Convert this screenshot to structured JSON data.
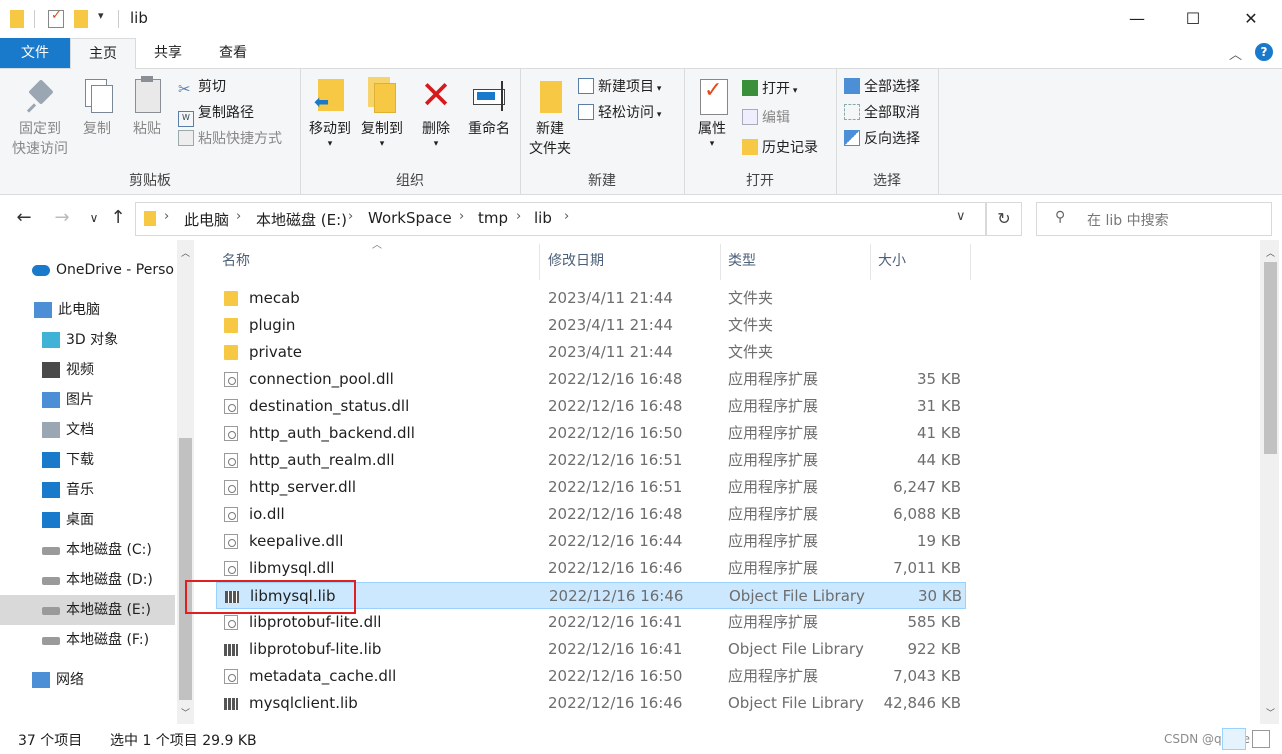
{
  "window": {
    "title": "lib"
  },
  "ribbon_tabs": [
    "文件",
    "主页",
    "共享",
    "查看"
  ],
  "ribbon": {
    "clipboard": {
      "label": "剪贴板",
      "pin_line1": "固定到",
      "pin_line2": "快速访问",
      "copy": "复制",
      "paste": "粘贴",
      "cut": "剪切",
      "copy_path": "复制路径",
      "paste_shortcut": "粘贴快捷方式"
    },
    "organize": {
      "label": "组织",
      "move_to": "移动到",
      "copy_to": "复制到",
      "delete": "删除",
      "rename": "重命名"
    },
    "new": {
      "label": "新建",
      "new_folder_line1": "新建",
      "new_folder_line2": "文件夹",
      "new_item": "新建项目",
      "easy_access": "轻松访问"
    },
    "open": {
      "label": "打开",
      "properties": "属性",
      "open": "打开",
      "edit": "编辑",
      "history": "历史记录"
    },
    "select": {
      "label": "选择",
      "select_all": "全部选择",
      "select_none": "全部取消",
      "invert": "反向选择"
    }
  },
  "address": {
    "crumbs": [
      "此电脑",
      "本地磁盘 (E:)",
      "WorkSpace",
      "tmp",
      "lib"
    ],
    "search_placeholder": "在 lib 中搜索"
  },
  "nav": [
    {
      "label": "OneDrive - Perso",
      "icon": "cloud-icon"
    },
    {
      "label": "此电脑",
      "icon": "computer-icon"
    },
    {
      "label": "3D 对象",
      "icon": "cube-icon"
    },
    {
      "label": "视频",
      "icon": "video-icon"
    },
    {
      "label": "图片",
      "icon": "picture-icon"
    },
    {
      "label": "文档",
      "icon": "document-icon"
    },
    {
      "label": "下载",
      "icon": "download-icon"
    },
    {
      "label": "音乐",
      "icon": "music-icon"
    },
    {
      "label": "桌面",
      "icon": "desktop-icon"
    },
    {
      "label": "本地磁盘 (C:)",
      "icon": "drive-icon"
    },
    {
      "label": "本地磁盘 (D:)",
      "icon": "drive-icon"
    },
    {
      "label": "本地磁盘 (E:)",
      "icon": "drive-icon",
      "selected": true
    },
    {
      "label": "本地磁盘 (F:)",
      "icon": "drive-icon"
    },
    {
      "label": "网络",
      "icon": "network-icon"
    }
  ],
  "columns": {
    "name": "名称",
    "date": "修改日期",
    "type": "类型",
    "size": "大小"
  },
  "files": [
    {
      "name": "mecab",
      "date": "2023/4/11 21:44",
      "type": "文件夹",
      "size": "",
      "kind": "folder"
    },
    {
      "name": "plugin",
      "date": "2023/4/11 21:44",
      "type": "文件夹",
      "size": "",
      "kind": "folder"
    },
    {
      "name": "private",
      "date": "2023/4/11 21:44",
      "type": "文件夹",
      "size": "",
      "kind": "folder"
    },
    {
      "name": "connection_pool.dll",
      "date": "2022/12/16 16:48",
      "type": "应用程序扩展",
      "size": "35 KB",
      "kind": "dll"
    },
    {
      "name": "destination_status.dll",
      "date": "2022/12/16 16:48",
      "type": "应用程序扩展",
      "size": "31 KB",
      "kind": "dll"
    },
    {
      "name": "http_auth_backend.dll",
      "date": "2022/12/16 16:50",
      "type": "应用程序扩展",
      "size": "41 KB",
      "kind": "dll"
    },
    {
      "name": "http_auth_realm.dll",
      "date": "2022/12/16 16:51",
      "type": "应用程序扩展",
      "size": "44 KB",
      "kind": "dll"
    },
    {
      "name": "http_server.dll",
      "date": "2022/12/16 16:51",
      "type": "应用程序扩展",
      "size": "6,247 KB",
      "kind": "dll"
    },
    {
      "name": "io.dll",
      "date": "2022/12/16 16:48",
      "type": "应用程序扩展",
      "size": "6,088 KB",
      "kind": "dll"
    },
    {
      "name": "keepalive.dll",
      "date": "2022/12/16 16:44",
      "type": "应用程序扩展",
      "size": "19 KB",
      "kind": "dll"
    },
    {
      "name": "libmysql.dll",
      "date": "2022/12/16 16:46",
      "type": "应用程序扩展",
      "size": "7,011 KB",
      "kind": "dll"
    },
    {
      "name": "libmysql.lib",
      "date": "2022/12/16 16:46",
      "type": "Object File Library",
      "size": "30 KB",
      "kind": "lib",
      "selected": true
    },
    {
      "name": "libprotobuf-lite.dll",
      "date": "2022/12/16 16:41",
      "type": "应用程序扩展",
      "size": "585 KB",
      "kind": "dll"
    },
    {
      "name": "libprotobuf-lite.lib",
      "date": "2022/12/16 16:41",
      "type": "Object File Library",
      "size": "922 KB",
      "kind": "lib"
    },
    {
      "name": "metadata_cache.dll",
      "date": "2022/12/16 16:50",
      "type": "应用程序扩展",
      "size": "7,043 KB",
      "kind": "dll"
    },
    {
      "name": "mysqlclient.lib",
      "date": "2022/12/16 16:46",
      "type": "Object File Library",
      "size": "42,846 KB",
      "kind": "lib"
    }
  ],
  "status": {
    "count": "37 个项目",
    "selection": "选中 1 个项目  29.9 KB"
  },
  "watermark": "CSDN @qasee"
}
